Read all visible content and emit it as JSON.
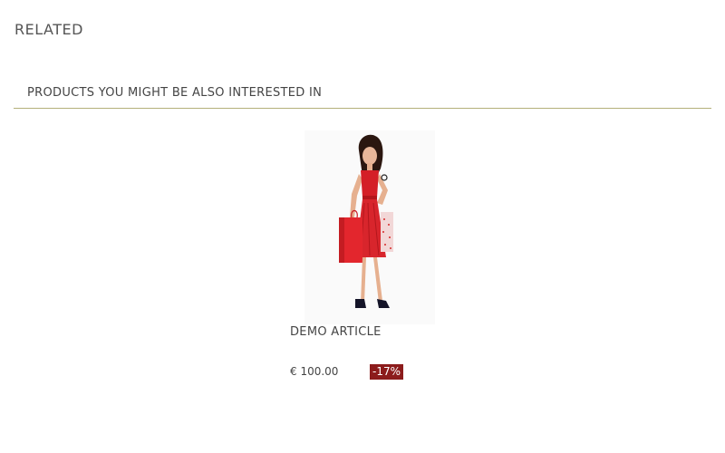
{
  "page": {
    "heading": "RELATED"
  },
  "section": {
    "title": "PRODUCTS YOU MIGHT BE ALSO INTERESTED IN",
    "rule_color": "#b4b07a"
  },
  "products": [
    {
      "name": "DEMO ARTICLE",
      "price": "€ 100.00",
      "discount": "-17%",
      "image_icon": "woman-in-red-dress-with-shopping-bags",
      "badge_color": "#8c1c1c"
    }
  ]
}
